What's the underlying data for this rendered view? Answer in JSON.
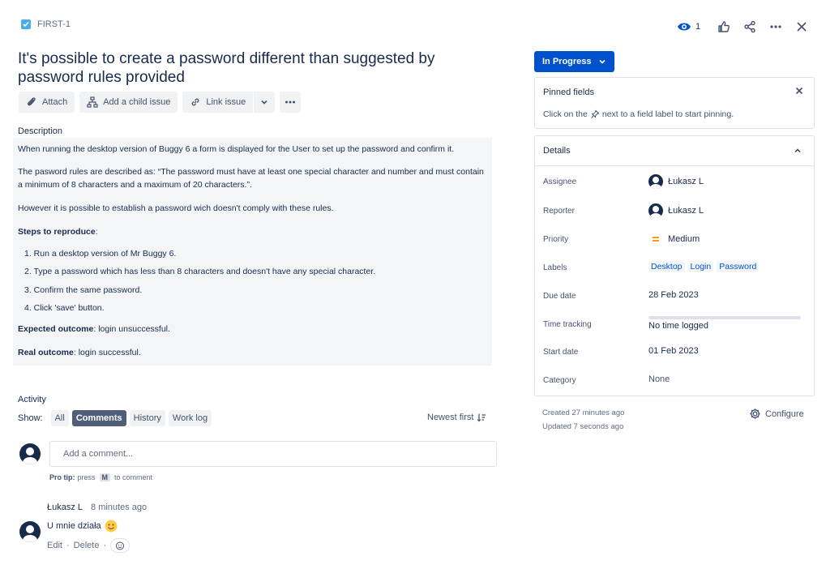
{
  "issue": {
    "key": "FIRST-1",
    "title": "It's possible to create a password different than suggested by password rules provided"
  },
  "header_actions": {
    "watch_count": "1"
  },
  "toolbar": {
    "attach": "Attach",
    "add_child": "Add a child issue",
    "link_issue": "Link issue"
  },
  "description": {
    "heading": "Description",
    "p1": "When running the desktop version of Buggy 6 a form is displayed for the User to set up the password and confirm it.",
    "p2": "The pasword rules are described as: “The password must have at least one special character and number and must contain a minimum of 8 characters and a maximum of 20 characters.”.",
    "p3": "However it is possible to establish a password wich doesn't comply with these rules.",
    "steps_heading": "Steps to reproduce",
    "steps_colon": ":",
    "steps": [
      "1.  Run a desktop version of Mr Buggy 6.",
      "2. Type a password which has less than 8 characters and doesn't have any special character.",
      "3.  Confirm the same password.",
      "4. Click 'save' button."
    ],
    "expected_label": "Expected outcome",
    "expected_text": ": login unsuccessful.",
    "real_label": "Real outcome",
    "real_text": ": login successful."
  },
  "activity": {
    "heading": "Activity",
    "show_label": "Show:",
    "tabs": [
      "All",
      "Comments",
      "History",
      "Work log"
    ],
    "active_tab": "Comments",
    "sort_label": "Newest first",
    "comment_placeholder": "Add a comment...",
    "pro_tip_bold": "Pro tip:",
    "pro_tip_press": "press",
    "pro_tip_key": "M",
    "pro_tip_rest": "to comment"
  },
  "comment": {
    "author": "Łukasz L",
    "time": "8 minutes ago",
    "body": "U mnie działa",
    "edit": "Edit",
    "delete": "Delete",
    "separator": "·"
  },
  "status": {
    "label": "In Progress"
  },
  "pinned": {
    "title": "Pinned fields",
    "hint_before": "Click on the",
    "hint_after": "next to a field label to start pinning."
  },
  "details": {
    "title": "Details",
    "assignee_label": "Assignee",
    "assignee": "Łukasz L",
    "reporter_label": "Reporter",
    "reporter": "Łukasz L",
    "priority_label": "Priority",
    "priority": "Medium",
    "labels_label": "Labels",
    "labels": [
      "Desktop",
      "Login",
      "Password"
    ],
    "due_label": "Due date",
    "due": "28 Feb 2023",
    "time_label": "Time tracking",
    "time_value": "No time logged",
    "start_label": "Start date",
    "start": "01 Feb 2023",
    "category_label": "Category",
    "category": "None"
  },
  "meta": {
    "created": "Created 27 minutes ago",
    "updated": "Updated 7 seconds ago",
    "configure": "Configure"
  },
  "colors": {
    "primary": "#0052cc",
    "priority": "#ff991f",
    "text": "#172b4d"
  }
}
